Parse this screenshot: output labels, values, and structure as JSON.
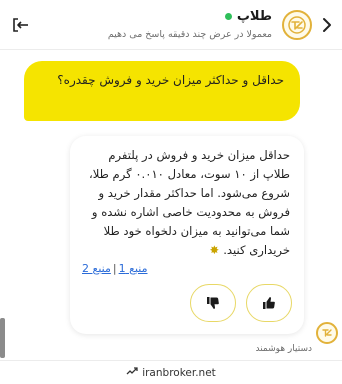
{
  "header": {
    "title": "طلاپ",
    "subtitle": "معمولا در عرض چند دقیقه پاسخ می دهیم",
    "online_color": "#2fbf5a",
    "logo_icon": "talap-logo-icon",
    "back_icon": "chevron-right-icon",
    "exit_icon": "exit-icon"
  },
  "messages": {
    "user": "حداقل و حداکثر میزان خرید و فروش چقدره؟",
    "bot": "حداقل میزان خرید و فروش در پلتفرم طلاپ از ۱۰ سوت، معادل ۰.۰۱۰ گرم طلا، شروع می‌شود. اما حداکثر مقدار خرید و فروش به محدودیت خاصی اشاره نشده و شما می‌توانید به میزان دلخواه خود طلا خریداری کنید.",
    "sources": [
      "منبع 1",
      "منبع 2"
    ],
    "feedback": {
      "like_icon": "thumbs-up-icon",
      "dislike_icon": "thumbs-down-icon"
    },
    "assistant_label": "دستیار هوشمند"
  },
  "footer": {
    "brand": "iranbroker.net",
    "icon": "chart-trend-icon"
  },
  "colors": {
    "accent_yellow": "#f5e400",
    "link_blue": "#2a6bd8"
  }
}
